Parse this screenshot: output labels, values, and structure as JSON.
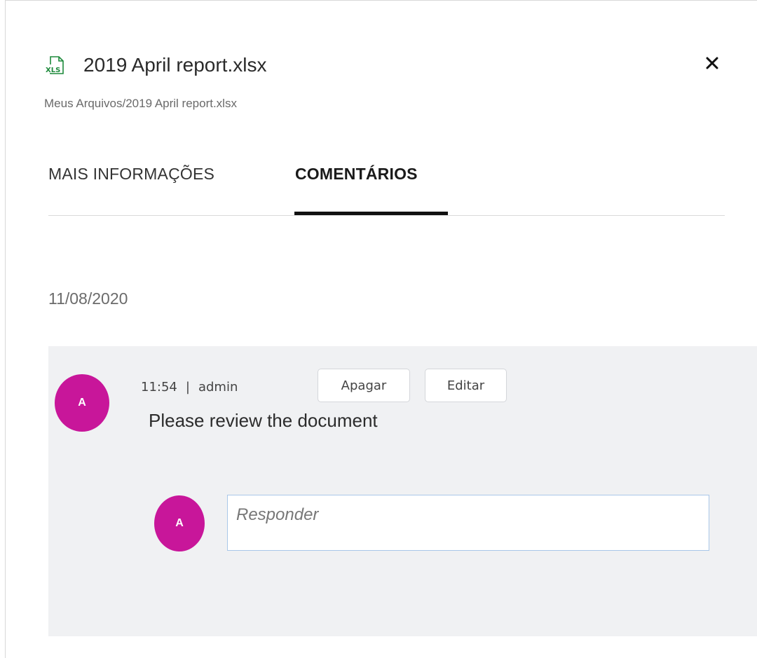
{
  "file": {
    "icon": "xls-file-icon",
    "icon_text": "XLS",
    "title": "2019 April report.xlsx",
    "path": "Meus Arquivos/2019 April report.xlsx"
  },
  "close_icon": "close-icon",
  "tabs": [
    {
      "label": "MAIS INFORMAÇÕES",
      "active": false
    },
    {
      "label": "COMENTÁRIOS",
      "active": true
    }
  ],
  "comments": {
    "date": "11/08/2020",
    "items": [
      {
        "avatar_initial": "A",
        "time": "11:54",
        "separator": "|",
        "author": "admin",
        "delete_label": "Apagar",
        "edit_label": "Editar",
        "text": "Please review the document"
      }
    ],
    "reply": {
      "avatar_initial": "A",
      "placeholder": "Responder"
    }
  },
  "colors": {
    "avatar": "#c8169a",
    "xls_green": "#1e8a3c",
    "comment_bg": "#f0f1f3",
    "input_border": "#a9c7e8"
  }
}
